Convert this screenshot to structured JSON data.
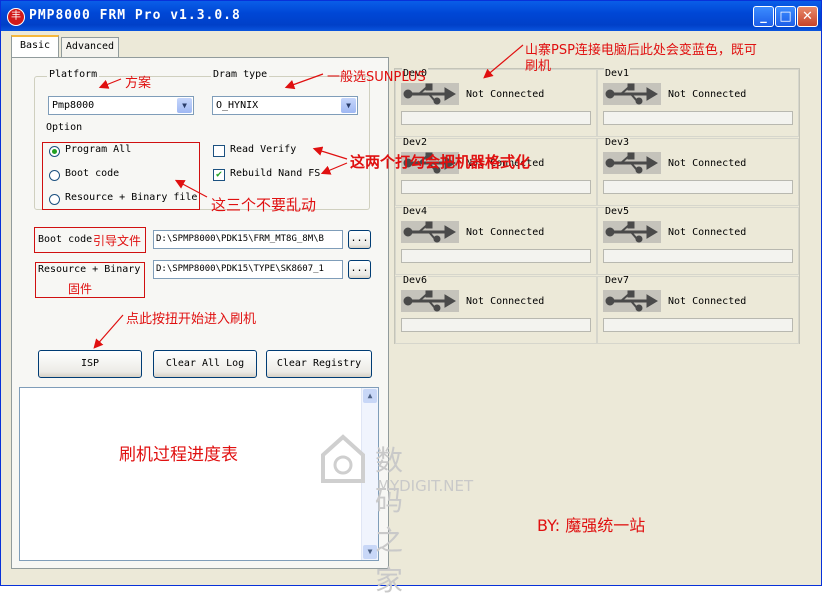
{
  "window": {
    "title": "PMP8000 FRM Pro v1.3.0.8",
    "icon_glyph": "丰",
    "min": "_",
    "max": "□",
    "close": "✕"
  },
  "tabs": [
    {
      "label": "Basic"
    },
    {
      "label": "Advanced"
    }
  ],
  "platform": {
    "label": "Platform",
    "value": "Pmp8000"
  },
  "dram": {
    "label": "Dram type",
    "value": "O_HYNIX"
  },
  "option": {
    "label": "Option",
    "radios": [
      {
        "label": "Program All",
        "checked": true
      },
      {
        "label": "Boot code"
      },
      {
        "label": "Resource + Binary file"
      }
    ],
    "checks": [
      {
        "label": "Read Verify",
        "checked": false
      },
      {
        "label": "Rebuild Nand FS",
        "checked": true
      }
    ]
  },
  "boot": {
    "label": "Boot code",
    "path": "D:\\SPMP8000\\PDK15\\FRM_MT8G_8M\\B",
    "browse": "..."
  },
  "resource": {
    "label": "Resource + Binary",
    "path": "D:\\SPMP8000\\PDK15\\TYPE\\SK8607_1",
    "browse": "..."
  },
  "buttons": {
    "isp": "ISP",
    "clear_log": "Clear All Log",
    "clear_registry": "Clear Registry"
  },
  "devices": [
    {
      "name": "Dev0",
      "status": "Not Connected"
    },
    {
      "name": "Dev1",
      "status": "Not Connected"
    },
    {
      "name": "Dev2",
      "status": "Not Connected"
    },
    {
      "name": "Dev3",
      "status": "Not Connected"
    },
    {
      "name": "Dev4",
      "status": "Not Connected"
    },
    {
      "name": "Dev5",
      "status": "Not Connected"
    },
    {
      "name": "Dev6",
      "status": "Not Connected"
    },
    {
      "name": "Dev7",
      "status": "Not Connected"
    }
  ],
  "annotations": {
    "scheme": "方案",
    "dram_note": "一般选SUNPLUS",
    "psp_note_1": "山寨PSP连接电脑后此处会变蓝色，既可",
    "psp_note_2": "刷机",
    "format_note": "这两个打勾会把机器格式化",
    "no_touch": "这三个不要乱动",
    "boot_file": "引导文件",
    "firmware": "固件",
    "click_isp": "点此按扭开始进入刷机",
    "progress": "刷机过程进度表",
    "author": "BY:  魔强统一站"
  },
  "watermark": {
    "cn": "数码之家",
    "en": "MYDIGIT.NET"
  },
  "colors": {
    "annotation_red": "#e01010",
    "title_blue": "#0047d6"
  }
}
